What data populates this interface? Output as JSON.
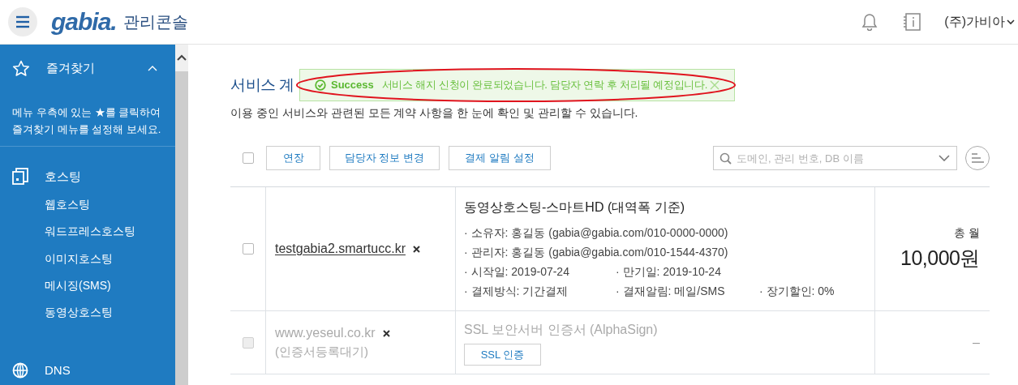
{
  "header": {
    "logo": "gabia.",
    "console_label": "관리콘솔",
    "account": "(주)가비아"
  },
  "sidebar": {
    "favorites": {
      "label": "즐겨찾기",
      "expanded": true,
      "hint": "메뉴 우측에 있는 ★를 클릭하여 즐겨찾기 메뉴를 설정해 보세요."
    },
    "sections": [
      {
        "kind": "hosting",
        "label": "호스팅",
        "children": [
          "웹호스팅",
          "워드프레스호스팅",
          "이미지호스팅",
          "메시징(SMS)",
          "동영상호스팅"
        ]
      },
      {
        "kind": "dns",
        "label": "DNS"
      }
    ]
  },
  "page": {
    "title": "서비스 계",
    "description": "이용 중인 서비스와 관련된 모든 계약 사항을 한 눈에 확인 및 관리할 수 있습니다."
  },
  "toast": {
    "status": "Success",
    "message": "서비스 해지 신청이 완료되었습니다. 담당자 연락 후 처리될 예정입니다."
  },
  "toolbar": {
    "select_all": {
      "checked": false
    },
    "buttons": [
      "연장",
      "담당자 정보 변경",
      "결제 알림 설정"
    ],
    "search": {
      "placeholder": "도메인, 관리 번호, DB 이름"
    }
  },
  "rows": [
    {
      "checked": false,
      "disabled": false,
      "domain": "testgabia2.smartucc.kr",
      "product": "동영상호스팅-스마트HD (대역폭 기준)",
      "details": [
        [
          "· 소유자: 홍길동 (gabia@gabia.com/010-0000-0000)"
        ],
        [
          "· 관리자: 홍길동 (gabia@gabia.com/010-1544-4370)"
        ],
        [
          "· 시작일: 2019-07-24",
          "· 만기일: 2019-10-24"
        ],
        [
          "· 결제방식: 기간결제",
          "· 결재알림: 메일/SMS",
          "· 장기할인: 0%"
        ]
      ],
      "price_label": "총 월",
      "price": "10,000원"
    },
    {
      "checked": false,
      "disabled": true,
      "domain": "www.yeseul.co.kr",
      "domain_note": "(인증서등록대기)",
      "product": "SSL 보안서버 인증서 (AlphaSign)",
      "action": "SSL 인증",
      "price": "–"
    }
  ]
}
